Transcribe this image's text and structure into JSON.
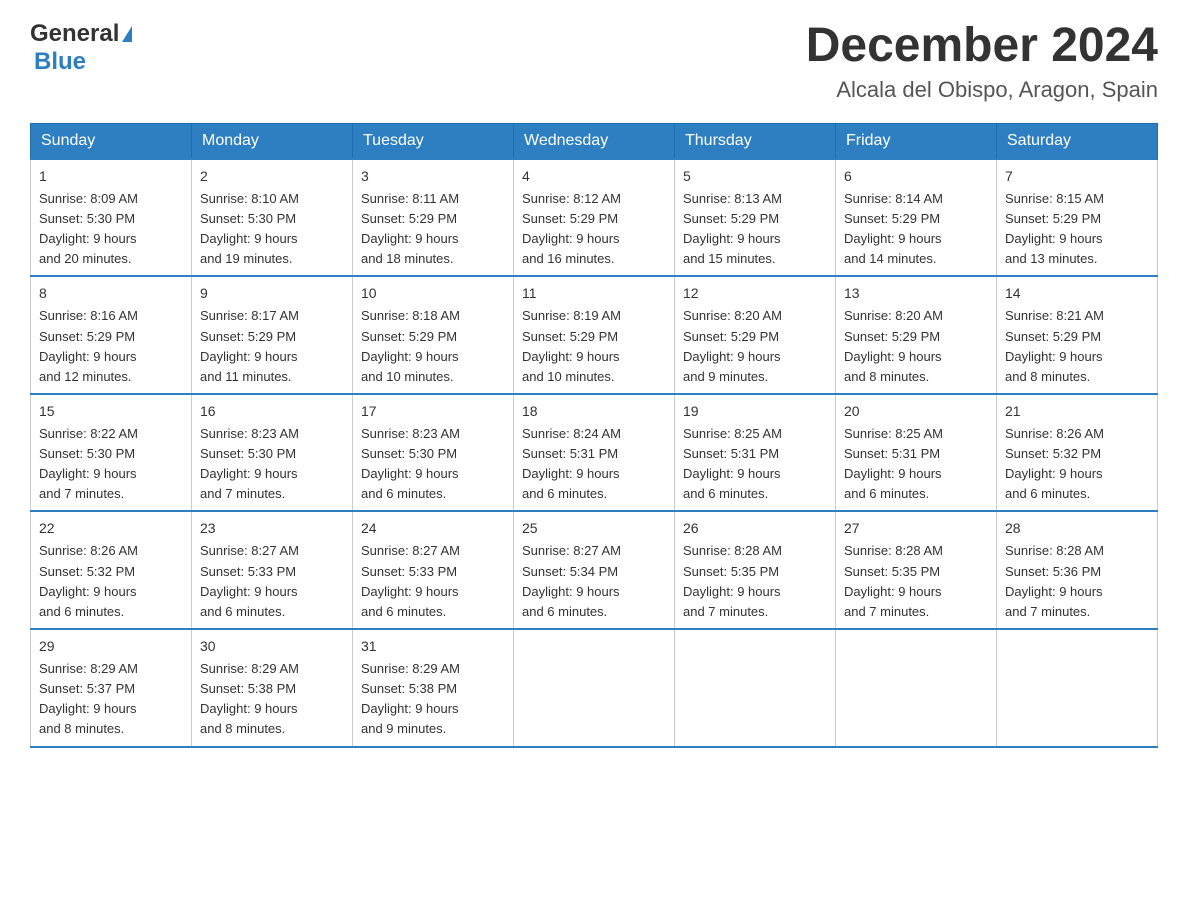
{
  "header": {
    "logo_general": "General",
    "logo_blue": "Blue",
    "month_title": "December 2024",
    "location": "Alcala del Obispo, Aragon, Spain"
  },
  "days_of_week": [
    "Sunday",
    "Monday",
    "Tuesday",
    "Wednesday",
    "Thursday",
    "Friday",
    "Saturday"
  ],
  "weeks": [
    [
      {
        "day": "1",
        "sunrise": "8:09 AM",
        "sunset": "5:30 PM",
        "daylight": "9 hours and 20 minutes."
      },
      {
        "day": "2",
        "sunrise": "8:10 AM",
        "sunset": "5:30 PM",
        "daylight": "9 hours and 19 minutes."
      },
      {
        "day": "3",
        "sunrise": "8:11 AM",
        "sunset": "5:29 PM",
        "daylight": "9 hours and 18 minutes."
      },
      {
        "day": "4",
        "sunrise": "8:12 AM",
        "sunset": "5:29 PM",
        "daylight": "9 hours and 16 minutes."
      },
      {
        "day": "5",
        "sunrise": "8:13 AM",
        "sunset": "5:29 PM",
        "daylight": "9 hours and 15 minutes."
      },
      {
        "day": "6",
        "sunrise": "8:14 AM",
        "sunset": "5:29 PM",
        "daylight": "9 hours and 14 minutes."
      },
      {
        "day": "7",
        "sunrise": "8:15 AM",
        "sunset": "5:29 PM",
        "daylight": "9 hours and 13 minutes."
      }
    ],
    [
      {
        "day": "8",
        "sunrise": "8:16 AM",
        "sunset": "5:29 PM",
        "daylight": "9 hours and 12 minutes."
      },
      {
        "day": "9",
        "sunrise": "8:17 AM",
        "sunset": "5:29 PM",
        "daylight": "9 hours and 11 minutes."
      },
      {
        "day": "10",
        "sunrise": "8:18 AM",
        "sunset": "5:29 PM",
        "daylight": "9 hours and 10 minutes."
      },
      {
        "day": "11",
        "sunrise": "8:19 AM",
        "sunset": "5:29 PM",
        "daylight": "9 hours and 10 minutes."
      },
      {
        "day": "12",
        "sunrise": "8:20 AM",
        "sunset": "5:29 PM",
        "daylight": "9 hours and 9 minutes."
      },
      {
        "day": "13",
        "sunrise": "8:20 AM",
        "sunset": "5:29 PM",
        "daylight": "9 hours and 8 minutes."
      },
      {
        "day": "14",
        "sunrise": "8:21 AM",
        "sunset": "5:29 PM",
        "daylight": "9 hours and 8 minutes."
      }
    ],
    [
      {
        "day": "15",
        "sunrise": "8:22 AM",
        "sunset": "5:30 PM",
        "daylight": "9 hours and 7 minutes."
      },
      {
        "day": "16",
        "sunrise": "8:23 AM",
        "sunset": "5:30 PM",
        "daylight": "9 hours and 7 minutes."
      },
      {
        "day": "17",
        "sunrise": "8:23 AM",
        "sunset": "5:30 PM",
        "daylight": "9 hours and 6 minutes."
      },
      {
        "day": "18",
        "sunrise": "8:24 AM",
        "sunset": "5:31 PM",
        "daylight": "9 hours and 6 minutes."
      },
      {
        "day": "19",
        "sunrise": "8:25 AM",
        "sunset": "5:31 PM",
        "daylight": "9 hours and 6 minutes."
      },
      {
        "day": "20",
        "sunrise": "8:25 AM",
        "sunset": "5:31 PM",
        "daylight": "9 hours and 6 minutes."
      },
      {
        "day": "21",
        "sunrise": "8:26 AM",
        "sunset": "5:32 PM",
        "daylight": "9 hours and 6 minutes."
      }
    ],
    [
      {
        "day": "22",
        "sunrise": "8:26 AM",
        "sunset": "5:32 PM",
        "daylight": "9 hours and 6 minutes."
      },
      {
        "day": "23",
        "sunrise": "8:27 AM",
        "sunset": "5:33 PM",
        "daylight": "9 hours and 6 minutes."
      },
      {
        "day": "24",
        "sunrise": "8:27 AM",
        "sunset": "5:33 PM",
        "daylight": "9 hours and 6 minutes."
      },
      {
        "day": "25",
        "sunrise": "8:27 AM",
        "sunset": "5:34 PM",
        "daylight": "9 hours and 6 minutes."
      },
      {
        "day": "26",
        "sunrise": "8:28 AM",
        "sunset": "5:35 PM",
        "daylight": "9 hours and 7 minutes."
      },
      {
        "day": "27",
        "sunrise": "8:28 AM",
        "sunset": "5:35 PM",
        "daylight": "9 hours and 7 minutes."
      },
      {
        "day": "28",
        "sunrise": "8:28 AM",
        "sunset": "5:36 PM",
        "daylight": "9 hours and 7 minutes."
      }
    ],
    [
      {
        "day": "29",
        "sunrise": "8:29 AM",
        "sunset": "5:37 PM",
        "daylight": "9 hours and 8 minutes."
      },
      {
        "day": "30",
        "sunrise": "8:29 AM",
        "sunset": "5:38 PM",
        "daylight": "9 hours and 8 minutes."
      },
      {
        "day": "31",
        "sunrise": "8:29 AM",
        "sunset": "5:38 PM",
        "daylight": "9 hours and 9 minutes."
      },
      null,
      null,
      null,
      null
    ]
  ],
  "labels": {
    "sunrise": "Sunrise:",
    "sunset": "Sunset:",
    "daylight": "Daylight:"
  }
}
